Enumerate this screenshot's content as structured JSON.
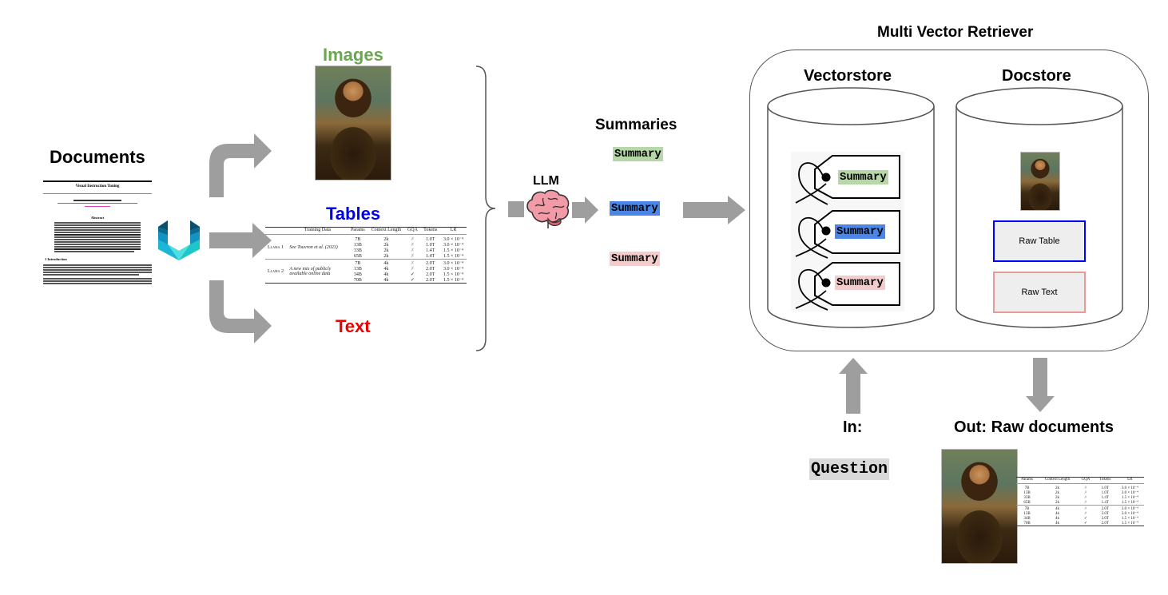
{
  "title": "Multi Vector Retriever",
  "documents": {
    "label": "Documents",
    "paper_title": "Visual Instruction Tuning",
    "abstract_heading": "Abstract",
    "intro_heading": "1 Introduction"
  },
  "branches": {
    "images": {
      "label": "Images",
      "color": "#6aa84f"
    },
    "tables": {
      "label": "Tables",
      "color": "#0000ee"
    },
    "text": {
      "label": "Text",
      "color": "#ee0000"
    }
  },
  "table_sample": {
    "headers": [
      "",
      "Training Data",
      "Params",
      "Context Length",
      "GQA",
      "Tokens",
      "LR"
    ],
    "groups": [
      {
        "model": "Llama 1",
        "training_data": "See Touvron et al. (2023)",
        "rows": [
          [
            "7B",
            "2k",
            "✗",
            "1.0T",
            "3.0 × 10⁻⁴"
          ],
          [
            "13B",
            "2k",
            "✗",
            "1.0T",
            "3.0 × 10⁻⁴"
          ],
          [
            "33B",
            "2k",
            "✗",
            "1.4T",
            "1.5 × 10⁻⁴"
          ],
          [
            "65B",
            "2k",
            "✗",
            "1.4T",
            "1.5 × 10⁻⁴"
          ]
        ]
      },
      {
        "model": "Llama 2",
        "training_data": "A new mix of publicly available online data",
        "rows": [
          [
            "7B",
            "4k",
            "✗",
            "2.0T",
            "3.0 × 10⁻⁴"
          ],
          [
            "13B",
            "4k",
            "✗",
            "2.0T",
            "3.0 × 10⁻⁴"
          ],
          [
            "34B",
            "4k",
            "✓",
            "2.0T",
            "1.5 × 10⁻⁴"
          ],
          [
            "70B",
            "4k",
            "✓",
            "2.0T",
            "1.5 × 10⁻⁴"
          ]
        ]
      }
    ]
  },
  "llm": {
    "label": "LLM"
  },
  "summaries": {
    "label": "Summaries",
    "items": [
      {
        "text": "Summary",
        "bg": "#b6d7a8"
      },
      {
        "text": "Summary",
        "bg": "#4a86e8"
      },
      {
        "text": "Summary",
        "bg": "#f4cccc"
      }
    ]
  },
  "retriever": {
    "title": "Multi Vector Retriever",
    "vectorstore": {
      "label": "Vectorstore"
    },
    "docstore": {
      "label": "Docstore",
      "raw_table": {
        "label": "Raw Table",
        "border": "#0000ff"
      },
      "raw_text": {
        "label": "Raw Text",
        "border": "#ea9999"
      }
    }
  },
  "input": {
    "label": "In:",
    "question": "Question",
    "question_bg": "#d9d9d9"
  },
  "output": {
    "label": "Out: Raw documents"
  }
}
